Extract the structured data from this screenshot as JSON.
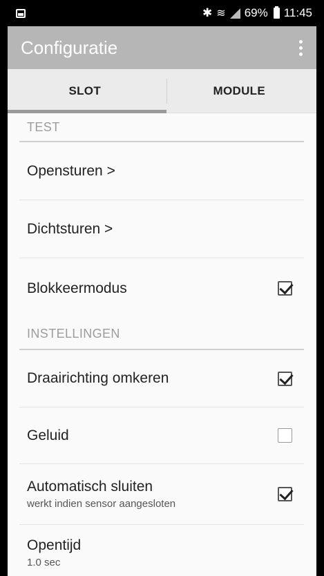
{
  "status_bar": {
    "battery_percent": "69%",
    "time": "11:45",
    "icons": [
      "gallery-icon",
      "bluetooth-icon",
      "wifi-icon",
      "signal-icon",
      "battery-icon"
    ]
  },
  "app_bar": {
    "title": "Configuratie",
    "menu_icon": "overflow-menu-icon"
  },
  "tabs": [
    {
      "label": "SLOT",
      "selected": true
    },
    {
      "label": "MODULE",
      "selected": false
    }
  ],
  "sections": {
    "test": {
      "header": "TEST",
      "items": [
        {
          "label": "Opensturen >"
        },
        {
          "label": "Dichtsturen >"
        },
        {
          "label": "Blokkeermodus",
          "checked": true
        }
      ]
    },
    "instellingen": {
      "header": "INSTELLINGEN",
      "items": [
        {
          "label": "Draairichting omkeren",
          "checked": true
        },
        {
          "label": "Geluid",
          "checked": false
        },
        {
          "label": "Automatisch sluiten",
          "summary": "werkt indien sensor aangesloten",
          "checked": true
        },
        {
          "label": "Opentijd",
          "summary": "1.0 sec"
        }
      ]
    }
  }
}
